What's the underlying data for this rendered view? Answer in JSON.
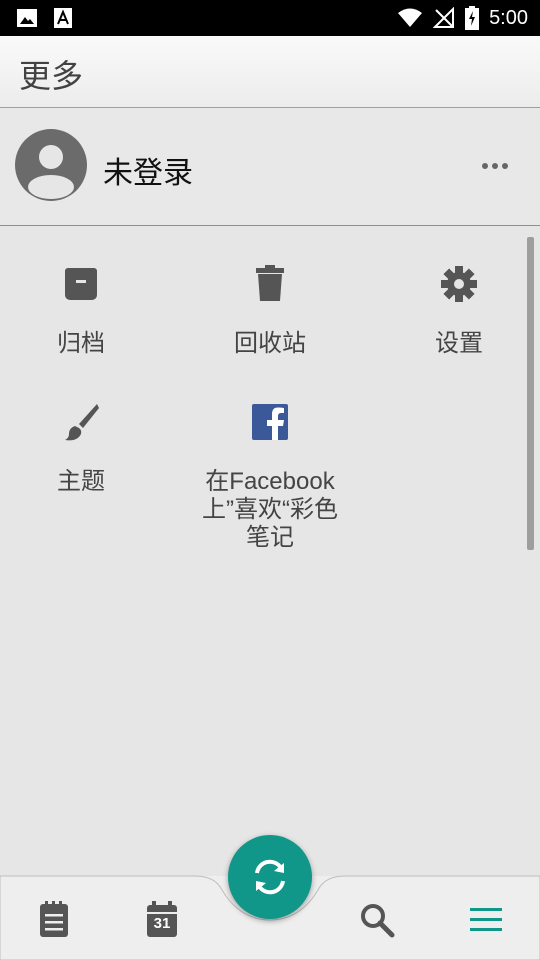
{
  "status_bar": {
    "time": "5:00",
    "icons": [
      "image-icon",
      "font-icon",
      "wifi-icon",
      "no-signal-icon",
      "battery-charging-icon"
    ]
  },
  "app_bar": {
    "title": "更多"
  },
  "account": {
    "name": "未登录",
    "avatar_icon": "account-circle-icon",
    "menu_icon": "more-horizontal-icon"
  },
  "grid": {
    "archive": {
      "label": "归档",
      "icon": "archive-icon"
    },
    "trash": {
      "label": "回收站",
      "icon": "trash-icon"
    },
    "settings": {
      "label": "设置",
      "icon": "gear-icon"
    },
    "theme": {
      "label": "主题",
      "icon": "brush-icon"
    },
    "facebook": {
      "label_lines": [
        "在Facebook",
        "上”喜欢“彩色",
        "笔记"
      ],
      "icon": "facebook-icon"
    }
  },
  "bottom_nav": {
    "items": [
      "notes-icon",
      "calendar-icon",
      "search-icon",
      "menu-icon"
    ],
    "calendar_day": "31",
    "active": "menu-icon",
    "fab_icon": "sync-icon"
  },
  "colors": {
    "accent": "#11968a",
    "icon_gray": "#555555",
    "facebook_blue": "#3b5998"
  }
}
